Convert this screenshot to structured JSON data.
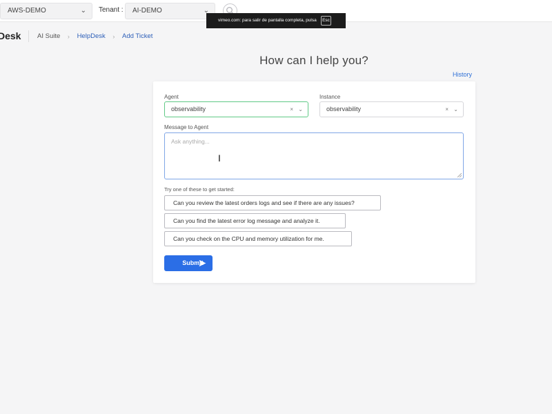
{
  "topbar": {
    "account_select": "AWS-DEMO",
    "tenant_label": "Tenant :",
    "tenant_select": "AI-DEMO"
  },
  "toast": {
    "message": "vimeo.com: para salir de pantalla completa, pulsa",
    "key": "Esc"
  },
  "breadcrumb": {
    "brand": "Desk",
    "items": [
      "AI Suite",
      "HelpDesk",
      "Add Ticket"
    ]
  },
  "page": {
    "title": "How can I help you?",
    "history_link": "History"
  },
  "form": {
    "agent_label": "Agent",
    "agent_value": "observability",
    "instance_label": "Instance",
    "instance_value": "observability",
    "message_label": "Message to Agent",
    "message_placeholder": "Ask anything...",
    "message_value": "",
    "suggestions_label": "Try one of these to get started:",
    "suggestions": [
      "Can you review the latest orders logs and see if there are any issues?",
      "Can you find the latest error log message and analyze it.",
      "Can you check on the CPU and memory utilization for me."
    ],
    "submit_label": "Submit"
  },
  "colors": {
    "accent": "#2b6ee6",
    "link": "#2d6fd6",
    "agent_focus_border": "#5fc985",
    "message_focus_border": "#7fa6e6"
  },
  "icons": {
    "select_chevron": "chevron-down-icon",
    "clear": "clear-x-icon",
    "search": "search-icon",
    "submit": "send-arrow-icon",
    "text_cursor": "text-cursor-icon"
  }
}
